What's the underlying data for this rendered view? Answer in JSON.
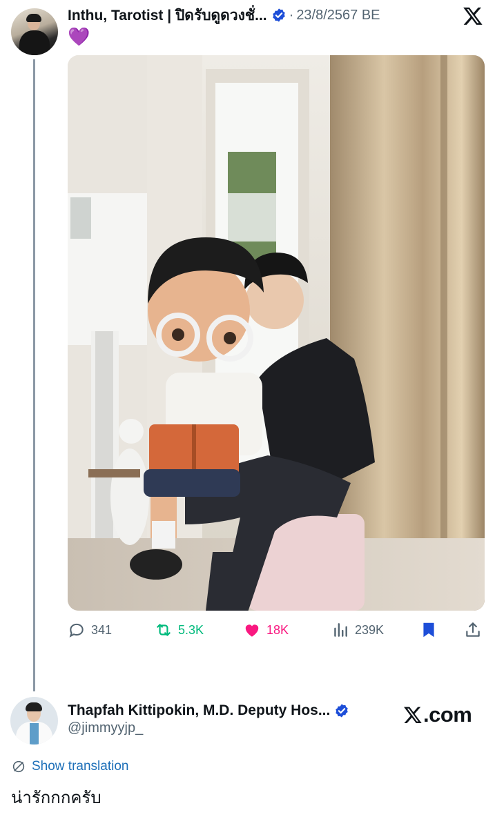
{
  "post": {
    "author_name": "Inthu, Tarotist | ปิดรับดูดวงชั่...",
    "separator": "·",
    "date": "23/8/2567 BE",
    "text": "💜",
    "image_alt": "photo",
    "icons": {
      "verified": "verified-badge-icon",
      "brand": "x-logo-icon"
    }
  },
  "actions": {
    "replies": "341",
    "reposts": "5.3K",
    "likes": "18K",
    "views": "239K"
  },
  "reply": {
    "author_name": "Thapfah Kittipokin, M.D. Deputy Hos...",
    "handle": "@jimmyyjp_",
    "brand": ".com",
    "translate_label": "Show translation",
    "text": "น่ารักกกครับ"
  },
  "colors": {
    "verified": "#1d4ed8",
    "repost": "#00ba7c",
    "like": "#f91880",
    "link": "#1d6fb8",
    "secondary_text": "#536471",
    "bookmark": "#1d4ed8"
  }
}
